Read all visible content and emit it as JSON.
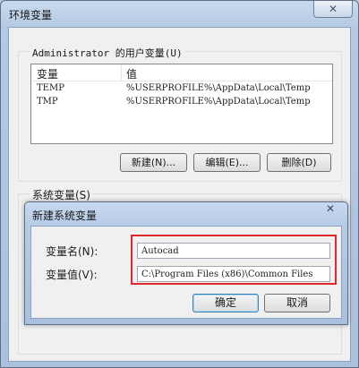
{
  "window": {
    "title": "环境变量",
    "close_glyph": "✕"
  },
  "user_vars": {
    "group_label": "Administrator 的用户变量(U)",
    "columns": [
      "变量",
      "值"
    ],
    "rows": [
      {
        "name": "TEMP",
        "value": "%USERPROFILE%\\AppData\\Local\\Temp"
      },
      {
        "name": "TMP",
        "value": "%USERPROFILE%\\AppData\\Local\\Temp"
      }
    ],
    "buttons": {
      "new": "新建(N)...",
      "edit": "编辑(E)...",
      "delete": "删除(D)"
    }
  },
  "system_vars": {
    "group_label": "系统变量(S)"
  },
  "dialog": {
    "title": "新建系统变量",
    "close_glyph": "✕",
    "name_label": "变量名(N):",
    "name_value": "Autocad",
    "value_label": "变量值(V):",
    "value_value": "C:\\Program Files (x86)\\Common Files",
    "ok_label": "确定",
    "cancel_label": "取消"
  },
  "colors": {
    "highlight": "#e0282c",
    "title_bar": "#b6cbe6"
  }
}
